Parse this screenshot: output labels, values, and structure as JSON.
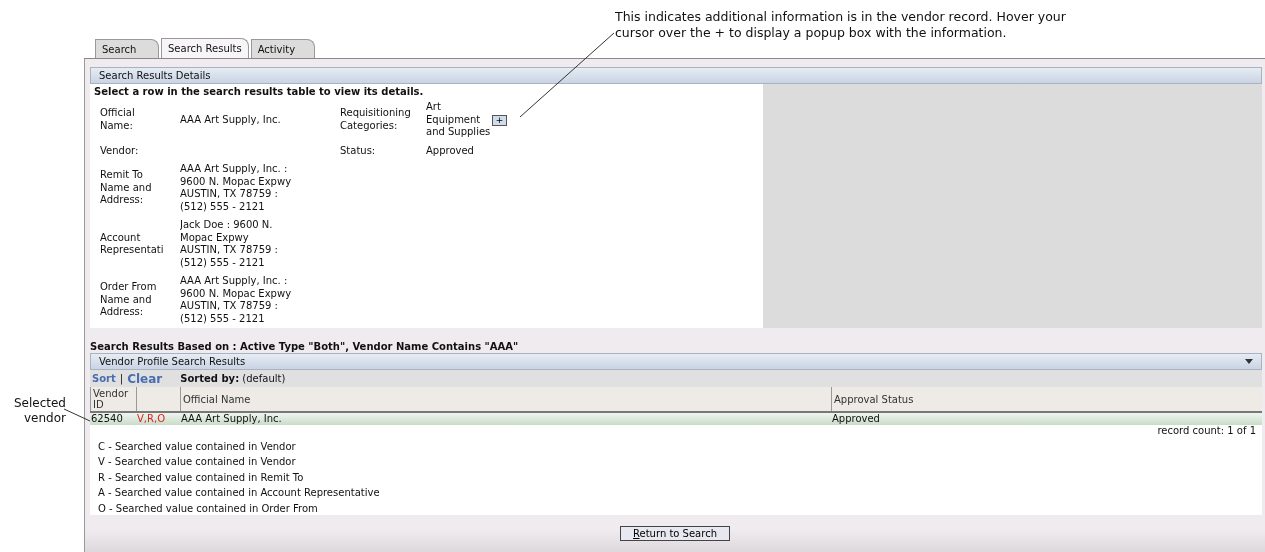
{
  "annotations": [
    {
      "kind": "top",
      "lines": [
        "This indicates additional information is in the vendor record. Hover your",
        "cursor over the + to display a popup box with the information."
      ]
    },
    {
      "kind": "left",
      "lines": [
        "Selected",
        "vendor"
      ]
    }
  ],
  "tabs": [
    {
      "label": "Search",
      "selected": false
    },
    {
      "label": "Search Results",
      "selected": true
    },
    {
      "label": "Activity",
      "selected": false
    }
  ],
  "details": {
    "header": "Search Results Details",
    "instruction": "Select a row in the search results table to view its details.",
    "left_fields": [
      {
        "label": "Official\nName:",
        "value": "AAA Art Supply, Inc."
      },
      {
        "label": "Vendor:"
      },
      {
        "label": "Remit To\nName and\nAddress:",
        "value": "AAA Art Supply, Inc. :\n9600 N. Mopac Expwy\nAUSTIN, TX 78759 :\n(512) 555 - 2121"
      },
      {
        "label": "Account\nRepresentati",
        "value": "Jack Doe : 9600 N.\nMopac Expwy\nAUSTIN, TX 78759 :\n(512) 555 - 2121"
      },
      {
        "label": "Order From\nName and\nAddress:",
        "value": "AAA Art Supply, Inc. :\n9600 N. Mopac Expwy\nAUSTIN, TX 78759 :\n(512) 555 - 2121"
      }
    ],
    "right_fields": [
      {
        "label": "Requisitioning\nCategories:",
        "value": "Art\nEquipment\nand Supplies",
        "more": "+"
      },
      {
        "label": "Status:",
        "value": "Approved"
      }
    ]
  },
  "results": {
    "criteria": "Search Results Based on : Active Type \"Both\", Vendor Name Contains \"AAA\"",
    "header": "Vendor Profile Search Results",
    "sort_link": "Sort",
    "separator": "|",
    "clear_link": "Clear",
    "sorted_by_label": "Sorted by:",
    "sorted_by_value": "(default)",
    "columns": [
      {
        "label": "Vendor\nID"
      },
      {},
      {
        "label": "Official Name"
      },
      {
        "label": "Approval Status"
      }
    ],
    "rows": [
      {
        "vendor_id": "62540",
        "flags": "V,R,O",
        "official_name": "AAA Art Supply, Inc.",
        "approval_status": "Approved",
        "selected": true
      }
    ],
    "record_count": "record count: 1 of 1",
    "legend": [
      "C - Searched value contained in Vendor",
      "V - Searched value contained in Vendor",
      "R - Searched value contained in Remit To",
      "A - Searched value contained in Account Representative",
      "O - Searched value contained in Order From"
    ]
  },
  "button": "Return to Search"
}
